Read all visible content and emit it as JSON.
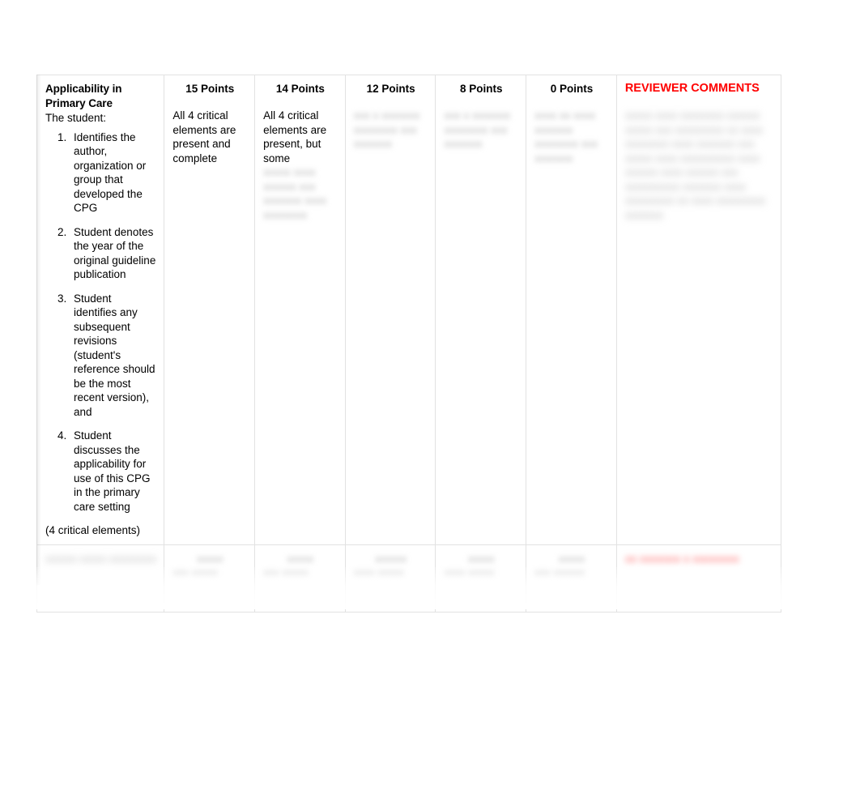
{
  "document": {
    "type": "grading-rubric-table"
  },
  "colors": {
    "reviewer_comments_heading": "#ff0000",
    "text": "#000000",
    "border": "#e2e2e2",
    "page_background": "#ffffff",
    "redacted_text": "#b8b8b8",
    "redacted_red_text": "#ff8a8a"
  },
  "table": {
    "criteria": {
      "title": "Applicability in Primary Care",
      "lead_in": "The student:",
      "items": [
        "Identifies the author, organization or group that developed the CPG",
        "Student denotes the year of the original guideline publication",
        "Student identifies any subsequent revisions (student's reference should be the most recent version), and",
        "Student discusses the applicability for use of this CPG in the primary care setting"
      ],
      "footer": "(4 critical elements)"
    },
    "columns": [
      {
        "header": "15 Points",
        "body": " All 4 critical elements are present and complete",
        "body_continued_redacted": ""
      },
      {
        "header": "14 Points",
        "body": "All 4 critical elements are present, but some",
        "body_continued_redacted": "xxxxx xxxx xxxxxx xxx xxxxxxx xxxx xxxxxxxx"
      },
      {
        "header": "12 Points",
        "body": "",
        "body_continued_redacted": "xxx x xxxxxxx xxxxxxxx xxx xxxxxxx"
      },
      {
        "header": "8 Points",
        "body": "",
        "body_continued_redacted": "xxx x xxxxxxx xxxxxxxx xxx xxxxxxx"
      },
      {
        "header": "0 Points",
        "body": "",
        "body_continued_redacted": "xxxx xx xxxx xxxxxxx xxxxxxxx xxx xxxxxxx"
      }
    ],
    "reviewer_comments": {
      "header": "REVIEWER COMMENTS",
      "body_redacted": "xxxxx xxxx xxxxxxxx xxxxxx xxxxx xxx xxxxxxxxx xx xxxx xxxxxxxx xxxx xxxxxxx xxx xxxxx xxxx xxxxxxxxxx xxxx xxxxxx xxxx xxxxxx xxx xxxxxxxxxx xxxxxxx xxxx xxxxxxxxx xx xxxx xxxxxxxxx xxxxxxx"
    },
    "score_row": {
      "criteria_redacted": "xxxxxx xxxxx xxxxxxxxx",
      "cells_redacted": [
        {
          "points_redacted": "xxxxx",
          "note_redacted": "xxx xxxxx"
        },
        {
          "points_redacted": "xxxxx",
          "note_redacted": "xxx xxxxx"
        },
        {
          "points_redacted": "xxxxxx",
          "note_redacted": "xxxx xxxxx"
        },
        {
          "points_redacted": "xxxxx",
          "note_redacted": "xxxx xxxxx"
        },
        {
          "points_redacted": "xxxxx",
          "note_redacted": "xxx xxxxxx"
        }
      ],
      "comments_redacted": "xx xxxxxxx x xxxxxxxx"
    }
  }
}
